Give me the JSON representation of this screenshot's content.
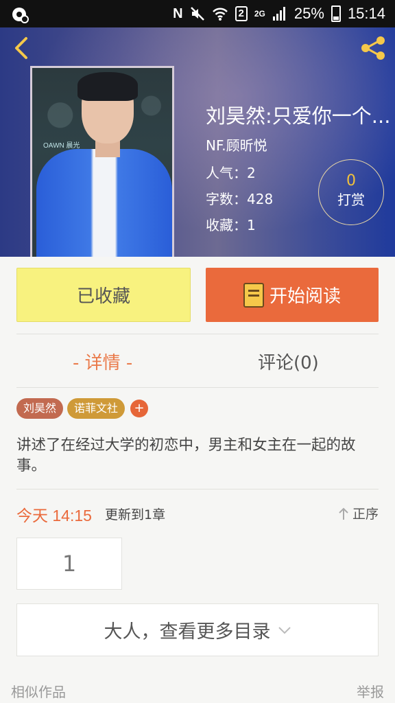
{
  "status_bar": {
    "battery": "25%",
    "time": "15:14",
    "sim_badge": "2",
    "network": "2G",
    "icons": [
      "notification-icon",
      "nfc-icon",
      "mute-icon",
      "wifi-icon",
      "sim-icon",
      "signal-icon",
      "battery-icon"
    ]
  },
  "header": {
    "book_title": "刘昊然:只爱你一个...",
    "author": "NF.顾昕悦",
    "popularity": "人气：2",
    "word_count": "字数：428",
    "favorites": "收藏：1",
    "reward": {
      "count": "0",
      "label": "打赏"
    },
    "cover_caption": "OAWN 晨光",
    "accent_color": "#f5c84a"
  },
  "actions": {
    "favorite_label": "已收藏",
    "read_label": "开始阅读"
  },
  "tabs": {
    "detail": "- 详情 -",
    "comment": "评论(0)"
  },
  "tags": [
    "刘昊然",
    "诺菲文社"
  ],
  "tag_add": "+",
  "description": "讲述了在经过大学的初恋中，男主和女主在一起的故事。",
  "update": {
    "time": "今天 14:15",
    "chapter_text": "更新到1章",
    "sort_label": "正序"
  },
  "chapters": [
    "1"
  ],
  "more_label": "大人，查看更多目录",
  "footer": {
    "similar": "相似作品",
    "report": "举报"
  }
}
